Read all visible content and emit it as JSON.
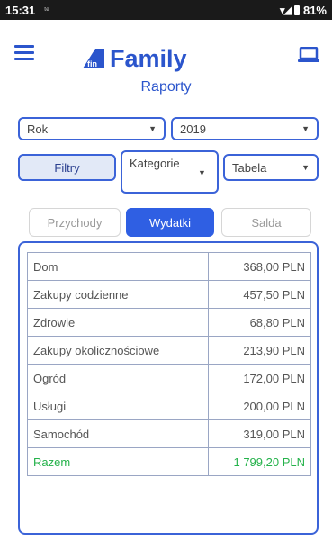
{
  "status_bar": {
    "time": "15:31",
    "carrier_icon": "ᵗᵉ",
    "battery_pct": "81%"
  },
  "header": {
    "brand": "Family",
    "logo_mark_text": "fin",
    "title": "Raporty",
    "brand_color": "#2b55cc"
  },
  "filters": {
    "period_value": "Rok",
    "year_value": "2019",
    "filter_button": "Filtry",
    "category_value": "Kategorie",
    "view_value": "Tabela"
  },
  "tabs": [
    {
      "label": "Przychody",
      "active": false
    },
    {
      "label": "Wydatki",
      "active": true
    },
    {
      "label": "Salda",
      "active": false
    }
  ],
  "report": {
    "rows": [
      {
        "category": "Dom",
        "amount": "368,00 PLN"
      },
      {
        "category": "Zakupy codzienne",
        "amount": "457,50 PLN"
      },
      {
        "category": "Zdrowie",
        "amount": "68,80 PLN"
      },
      {
        "category": "Zakupy okolicznościowe",
        "amount": "213,90 PLN"
      },
      {
        "category": "Ogród",
        "amount": "172,00 PLN"
      },
      {
        "category": "Usługi",
        "amount": "200,00 PLN"
      },
      {
        "category": "Samochód",
        "amount": "319,00 PLN"
      }
    ],
    "total": {
      "category": "Razem",
      "amount": "1 799,20 PLN"
    },
    "total_color": "#24b24a"
  }
}
